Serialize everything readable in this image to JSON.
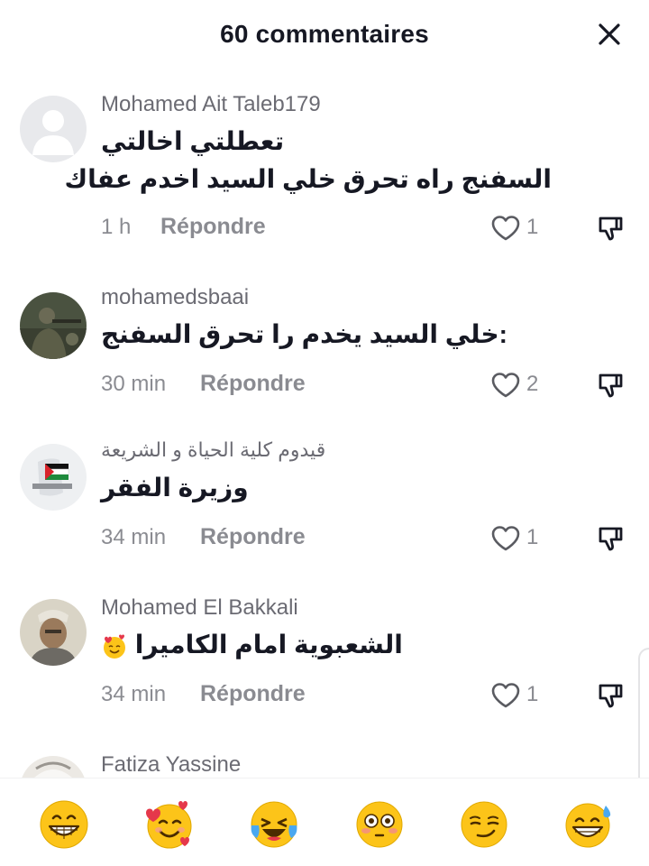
{
  "header": {
    "title": "60 commentaires",
    "close_icon": "close-icon"
  },
  "comments": [
    {
      "username": "Mohamed Ait Taleb179",
      "lines": [
        "تعطلتي اخالتي",
        "السفنج راه تحرق خلي السيد اخدم عفاك"
      ],
      "time": "1 h",
      "reply_label": "Répondre",
      "likes": "1"
    },
    {
      "username": "mohamedsbaai",
      "lines": [
        ":خلي السيد يخدم را تحرق السفنج"
      ],
      "time": "30 min",
      "reply_label": "Répondre",
      "likes": "2"
    },
    {
      "username": "قيدوم كلية الحياة و الشريعة",
      "lines": [
        "وزيرة الفقر"
      ],
      "time": "34 min",
      "reply_label": "Répondre",
      "likes": "1"
    },
    {
      "username": "Mohamed El Bakkali",
      "lines": [
        "الشعبوية امام الكاميرا"
      ],
      "time": "34 min",
      "reply_label": "Répondre",
      "likes": "1"
    },
    {
      "username": "Fatiza Yassine"
    }
  ],
  "emoji_bar": [
    "grinning-face",
    "smiling-face-with-hearts",
    "crying-laughing-face",
    "flushed-face",
    "smirking-face",
    "grinning-sweat-face"
  ],
  "colors": {
    "text": "#161823",
    "secondary": "#8a8b91",
    "emoji_yellow": "#fcc419",
    "heart_red": "#e5384b"
  }
}
